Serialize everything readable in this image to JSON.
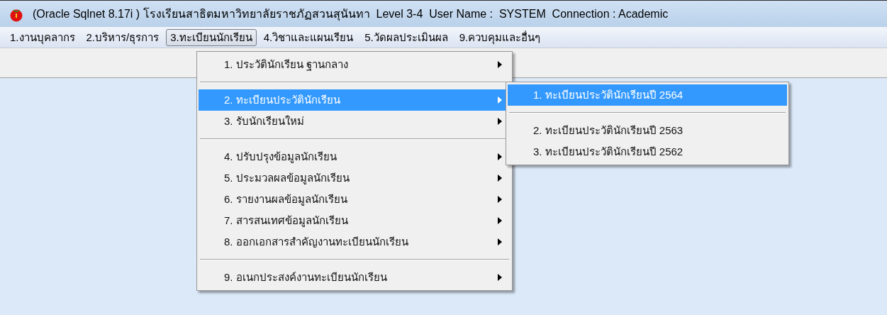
{
  "window": {
    "title": "(Oracle Sqlnet 8.17i ) โรงเรียนสาธิตมหาวิทยาลัยราชภัฏสวนสุนันทา  Level 3-4  User Name :  SYSTEM  Connection : Academic"
  },
  "menu_bar": [
    {
      "label": "1.งานบุคลากร",
      "selected": false
    },
    {
      "label": "2.บริหาร/ธุรการ",
      "selected": false
    },
    {
      "label": "3.ทะเบียนนักเรียน",
      "selected": true
    },
    {
      "label": "4.วิชาและแผนเรียน",
      "selected": false
    },
    {
      "label": "5.วัดผลประเมินผล",
      "selected": false
    },
    {
      "label": "9.ควบคุมและอื่นๆ",
      "selected": false
    }
  ],
  "dropdown_menu": {
    "items": [
      {
        "kind": "item",
        "label": "1. ประวัตินักเรียน ฐานกลาง",
        "selected": false
      },
      {
        "kind": "separator"
      },
      {
        "kind": "item",
        "label": "2. ทะเบียนประวัตินักเรียน",
        "selected": true
      },
      {
        "kind": "item",
        "label": "3. รับนักเรียนใหม่",
        "selected": false
      },
      {
        "kind": "separator"
      },
      {
        "kind": "item",
        "label": "4. ปรับปรุงข้อมูลนักเรียน",
        "selected": false
      },
      {
        "kind": "item",
        "label": "5. ประมวลผลข้อมูลนักเรียน",
        "selected": false
      },
      {
        "kind": "item",
        "label": "6. รายงานผลข้อมูลนักเรียน",
        "selected": false
      },
      {
        "kind": "item",
        "label": "7. สารสนเทศข้อมูลนักเรียน",
        "selected": false
      },
      {
        "kind": "item",
        "label": "8. ออกเอกสารสำคัญงานทะเบียนนักเรียน",
        "selected": false
      },
      {
        "kind": "separator"
      },
      {
        "kind": "item",
        "label": "9. อเนกประสงค์งานทะเบียนนักเรียน",
        "selected": false
      }
    ]
  },
  "submenu": {
    "items": [
      {
        "kind": "item",
        "label": "1. ทะเบียนประวัตินักเรียนปี 2564",
        "selected": true
      },
      {
        "kind": "separator"
      },
      {
        "kind": "item",
        "label": "2. ทะเบียนประวัตินักเรียนปี 2563",
        "selected": false
      },
      {
        "kind": "item",
        "label": "3. ทะเบียนประวัตินักเรียนปี 2562",
        "selected": false
      }
    ]
  }
}
